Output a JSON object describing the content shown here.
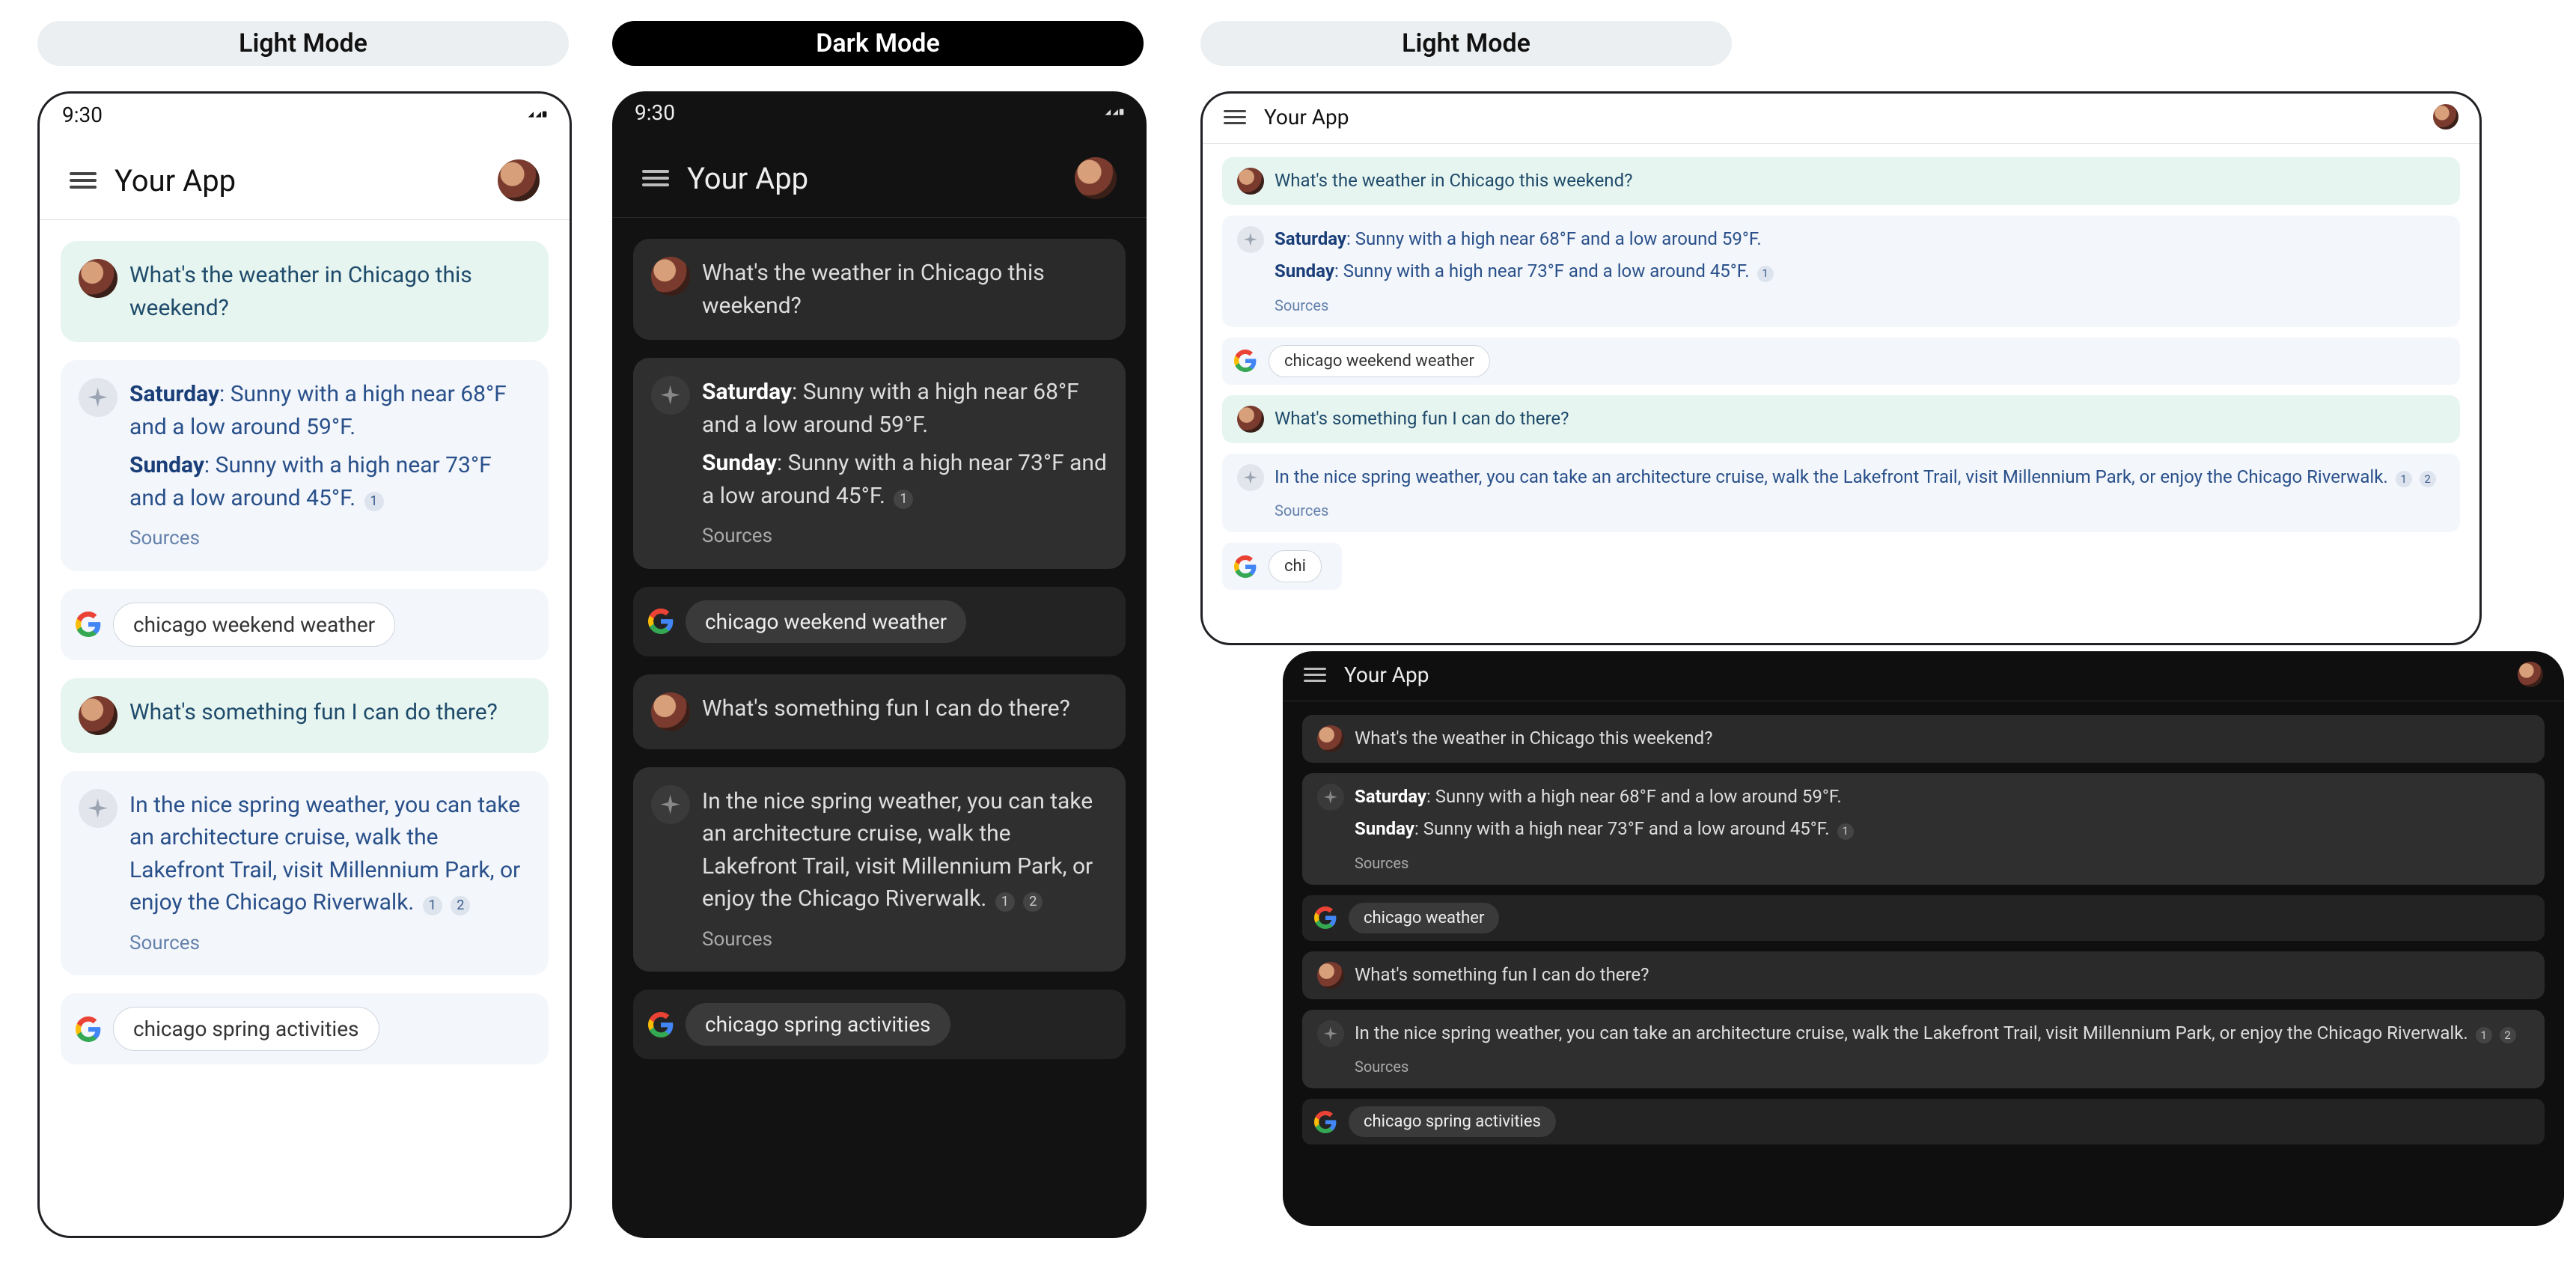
{
  "mode_labels": {
    "light": "Light Mode",
    "dark": "Dark Mode"
  },
  "status": {
    "time": "9:30"
  },
  "app": {
    "title": "Your App"
  },
  "q1": "What's the weather in Chicago this weekend?",
  "a1_sat_label": "Saturday",
  "a1_sat_text": ": Sunny with a high near 68°F and a low around 59°F.",
  "a1_sun_label": "Sunday",
  "a1_sun_text": ": Sunny with a high near 73°F and a low around 45°F.",
  "sources_label": "Sources",
  "cite1": "1",
  "cite2": "2",
  "chip_weather_long": "chicago weekend weather",
  "chip_weather_short": "chicago weather",
  "q2": "What's something fun I can do there?",
  "a2_text": "In the nice spring weather, you can take an architecture cruise, walk the Lakefront Trail, visit Millennium Park, or enjoy the Chicago Riverwalk.",
  "chip_activities": "chicago spring activities"
}
